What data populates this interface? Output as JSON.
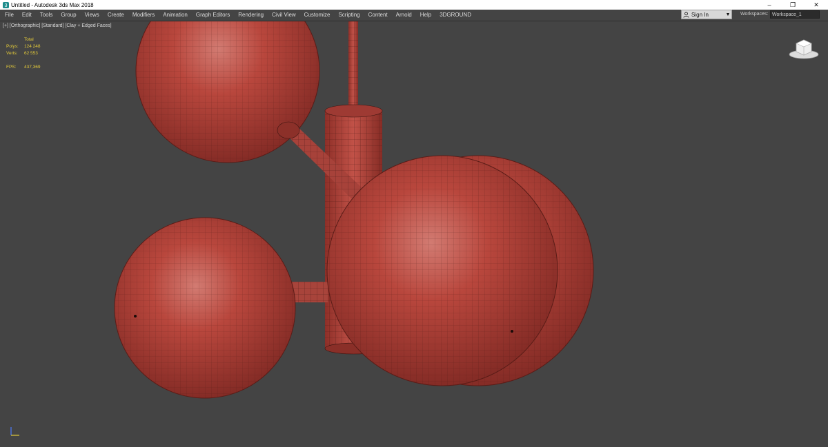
{
  "titlebar": {
    "title": "Untitled - Autodesk 3ds Max 2018",
    "app_icon": "3dsmax-app-icon",
    "minimize": "–",
    "restore": "❐",
    "close": "✕"
  },
  "menu": {
    "items": [
      "File",
      "Edit",
      "Tools",
      "Group",
      "Views",
      "Create",
      "Modifiers",
      "Animation",
      "Graph Editors",
      "Rendering",
      "Civil View",
      "Customize",
      "Scripting",
      "Content",
      "Arnold",
      "Help",
      "3DGROUND"
    ]
  },
  "signin": {
    "label": "Sign In",
    "icon": "user-icon",
    "caret": "▼"
  },
  "workspaces": {
    "label": "Workspaces:",
    "value": "Workspace_1"
  },
  "viewport": {
    "label": "[+] [Orthographic] [Standard] [Clay + Edged Faces]",
    "stats": {
      "header": "Total",
      "polys_label": "Polys:",
      "polys_value": "124 248",
      "verts_label": "Verts:",
      "verts_value": "62 553",
      "fps_label": "FPS:",
      "fps_value": "437,369"
    },
    "colors": {
      "background": "#444444",
      "clay": "#b8463c",
      "wire": "#3a1410",
      "stats": "#e2c93a"
    }
  }
}
